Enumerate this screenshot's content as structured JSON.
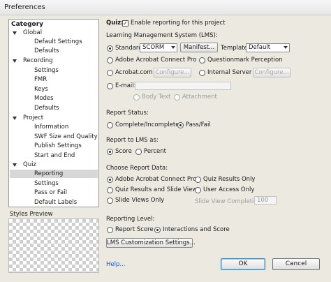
{
  "window": {
    "title": "Preferences"
  },
  "category": {
    "title": "Category",
    "groups": [
      {
        "label": "Global",
        "items": [
          "Default Settings",
          "Defaults"
        ]
      },
      {
        "label": "Recording",
        "items": [
          "Settings",
          "FMR",
          "Keys",
          "Modes",
          "Defaults"
        ]
      },
      {
        "label": "Project",
        "items": [
          "Information",
          "SWF Size and Quality",
          "Publish Settings",
          "Start and End"
        ]
      },
      {
        "label": "Quiz",
        "items": [
          "Reporting",
          "Settings",
          "Pass or Fail",
          "Default Labels"
        ]
      }
    ],
    "selected": "Reporting"
  },
  "styles_preview": {
    "label": "Styles Preview"
  },
  "quiz": {
    "label": "Quiz:",
    "enable_label": "Enable reporting for this project",
    "enabled": true
  },
  "lms": {
    "heading": "Learning Management System (LMS):",
    "standard_label": "Standard:",
    "standard_value": "SCORM",
    "manifest_button": "Manifest...",
    "template_label": "Template:",
    "template_value": "Default",
    "adobe_connect": "Adobe Acrobat Connect Pro",
    "questionmark": "Questionmark Perception",
    "acrobat": "Acrobat.com",
    "configure_1": "Configure...",
    "internal_server": "Internal Server",
    "configure_2": "Configure...",
    "email_label": "E-mail:",
    "email_value": "",
    "body_text": "Body Text",
    "attachment": "Attachment",
    "selected": "Standard"
  },
  "report_status": {
    "heading": "Report Status:",
    "options": [
      "Complete/Incomplete",
      "Pass/Fail"
    ],
    "selected": "Pass/Fail"
  },
  "report_to_lms": {
    "heading": "Report to LMS as:",
    "options": [
      "Score",
      "Percent"
    ],
    "selected": "Score"
  },
  "report_data": {
    "heading": "Choose Report Data:",
    "options": [
      "Adobe Acrobat Connect Pro",
      "Quiz Results Only",
      "Quiz Results and Slide Views",
      "User Access Only",
      "Slide Views Only"
    ],
    "slide_view_completion_label": "Slide View Completion",
    "slide_view_completion_value": "100",
    "selected": "Adobe Acrobat Connect Pro"
  },
  "reporting_level": {
    "heading": "Reporting Level:",
    "options": [
      "Report Score",
      "Interactions and Score"
    ],
    "selected": "Interactions and Score"
  },
  "lms_customization_button": "LMS Customization Settings...",
  "footer": {
    "help": "Help...",
    "ok": "OK",
    "cancel": "Cancel"
  }
}
